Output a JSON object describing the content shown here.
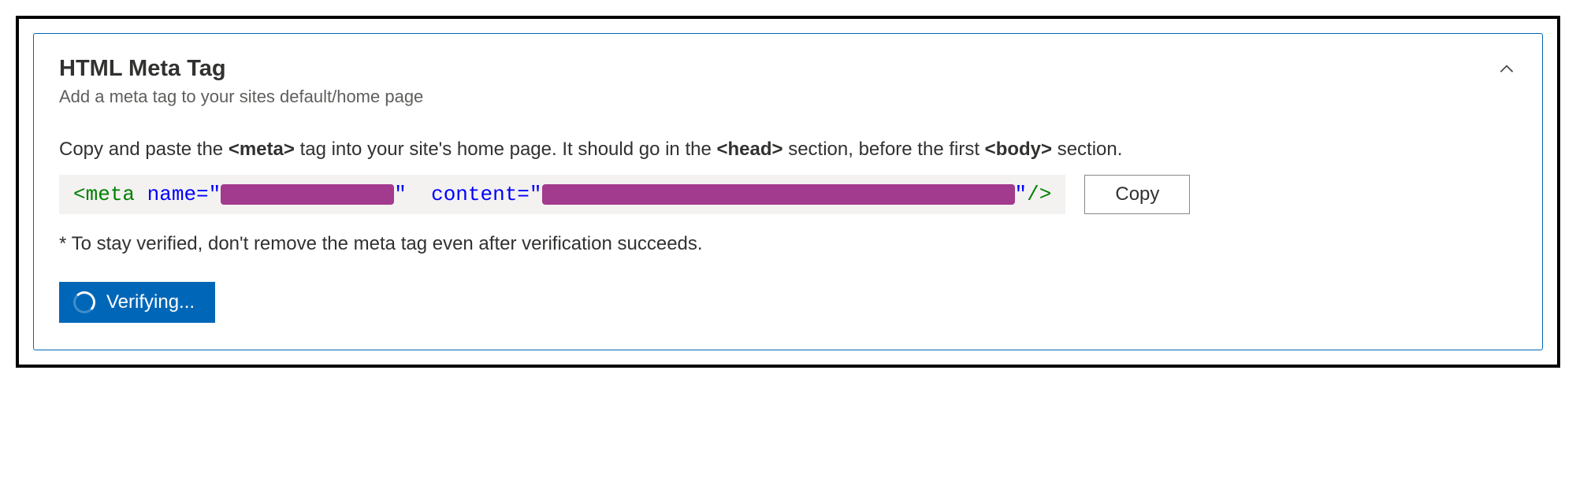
{
  "panel": {
    "title": "HTML Meta Tag",
    "subtitle": "Add a meta tag to your sites default/home page"
  },
  "instruction": {
    "pre": "Copy and paste the ",
    "tag_meta": "<meta>",
    "mid1": " tag into your site's home page. It should go in the ",
    "tag_head": "<head>",
    "mid2": " section, before the first ",
    "tag_body": "<body>",
    "post": " section."
  },
  "code": {
    "open_bracket": "<",
    "element": "meta",
    "space1": " ",
    "attr_name": "name=",
    "quote": "\"",
    "name_value_redacted": true,
    "space2": "  ",
    "attr_content": "content=",
    "content_value_redacted": true,
    "close": " />"
  },
  "actions": {
    "copy_label": "Copy",
    "verify_label": "Verifying..."
  },
  "note": "* To stay verified, don't remove the meta tag even after verification succeeds."
}
